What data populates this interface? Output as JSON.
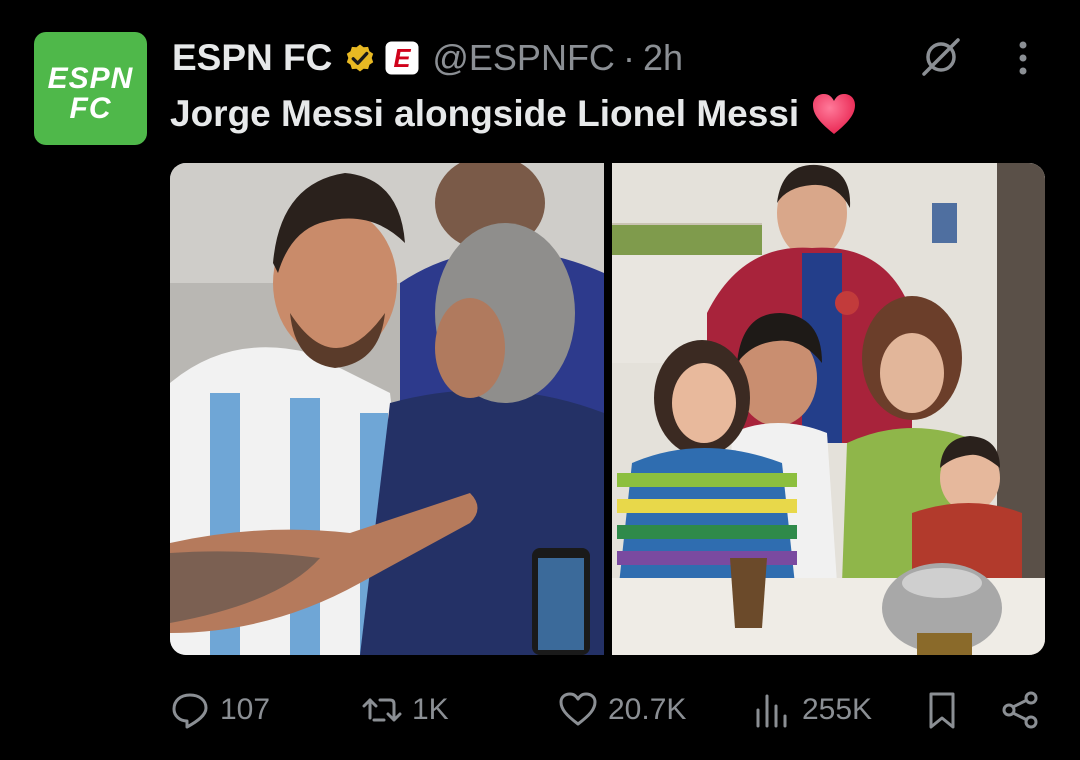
{
  "tweet": {
    "account_name": "ESPN FC",
    "avatar_text_top": "ESPN",
    "avatar_text_bottom": "FC",
    "verified_badge": "gold-verified-check",
    "affiliate_badge_letter": "E",
    "handle": "@ESPNFC",
    "separator": "·",
    "time": "2h",
    "text": "Jorge Messi alongside Lionel Messi",
    "emoji": "red-heart"
  },
  "media": {
    "images": [
      {
        "name": "messi-hugging-father-photo"
      },
      {
        "name": "messi-family-photo"
      }
    ]
  },
  "actions": {
    "reply_count": "107",
    "retweet_count": "1K",
    "like_count": "20.7K",
    "views_count": "255K"
  },
  "colors": {
    "background": "#000000",
    "text_primary": "#e7e9ea",
    "text_secondary": "#8b8f94",
    "espn_green": "#4fb84a",
    "verified_gold": "#e8b923",
    "espn_red": "#d0021b"
  }
}
